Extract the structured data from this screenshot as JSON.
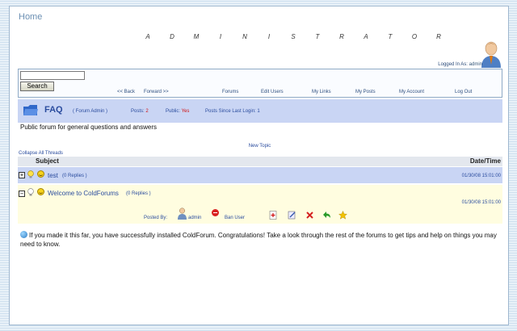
{
  "home": "Home",
  "admin_title_letters": [
    "A",
    "D",
    "M",
    "I",
    "N",
    "I",
    "S",
    "T",
    "R",
    "A",
    "T",
    "O",
    "R"
  ],
  "login": {
    "label": "Logged In As:",
    "user": "admin"
  },
  "search": {
    "placeholder": "",
    "button": "Search"
  },
  "nav": [
    "<< Back",
    "Forward >>",
    "Forums",
    "Edit Users",
    "My Links",
    "My Posts",
    "My Account",
    "Log Out"
  ],
  "forum": {
    "title": "FAQ",
    "admin_link": "( Forum Admin )",
    "posts_label": "Posts:",
    "posts_value": "2",
    "public_label": "Public:",
    "public_value": "Yes",
    "since_label": "Posts Since Last Login:",
    "since_value": "1",
    "description": "Public forum for general questions and answers"
  },
  "new_topic": "New Topic",
  "collapse_all": "Collapse All Threads",
  "table": {
    "subject_header": "Subject",
    "date_header": "Date/Time"
  },
  "threads": [
    {
      "toggle": "+",
      "title": "test",
      "replies": "(0 Replies )",
      "date": "01/30/08 15:01:00"
    },
    {
      "toggle": "−",
      "title": "Welcome to ColdForums",
      "replies": "(0 Replies )",
      "date": "01/30/08 15:01:00",
      "posted_by": "Posted By:",
      "author": "admin",
      "ban": "Ban User"
    }
  ],
  "message": "If you made it this far, you have successfully installed ColdForum. Congratulations! Take a look through the rest of the forums to get tips and help on things you may need to know.",
  "colors": {
    "header_bg": "#c9d5f4",
    "row_highlight": "#fffde0",
    "link": "#2a4c9e",
    "red": "#d01010"
  },
  "icons": [
    "user-avatar-icon",
    "folder-icon",
    "expand-icon",
    "bulb-icon",
    "smiley-icon",
    "user-icon",
    "ban-icon",
    "new-post-icon",
    "edit-icon",
    "delete-icon",
    "reply-icon",
    "star-icon",
    "globe-icon"
  ]
}
